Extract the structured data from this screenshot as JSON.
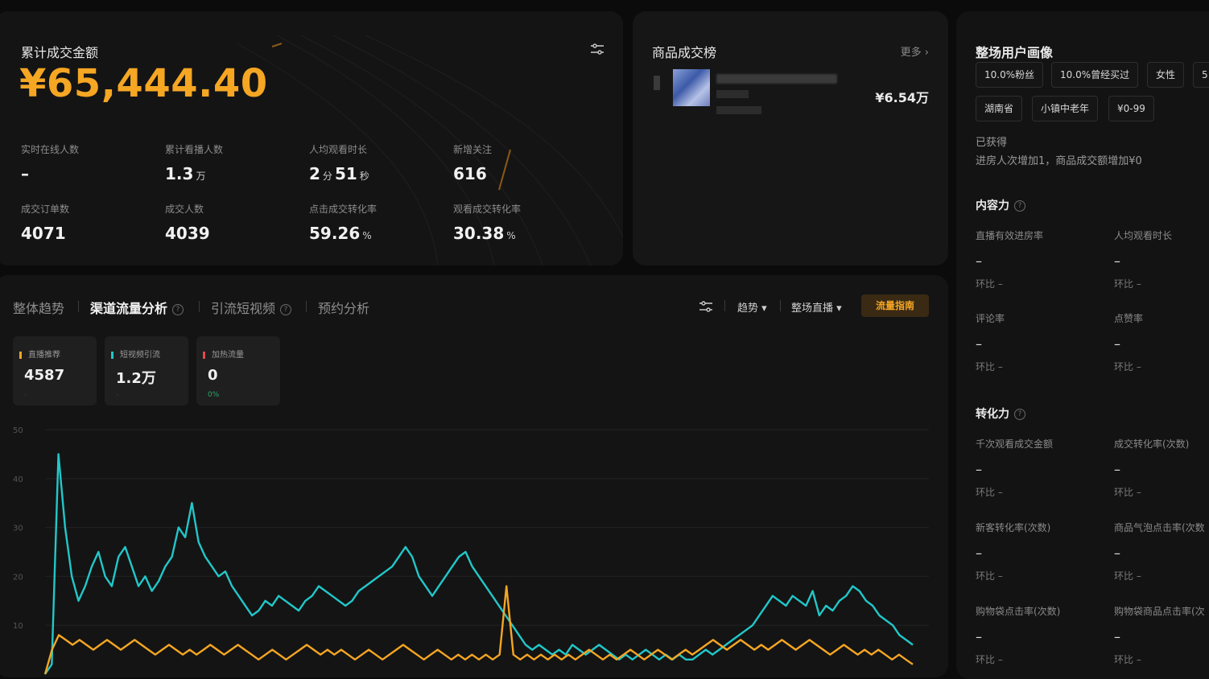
{
  "stats": {
    "title": "累计成交金额",
    "amount": "¥65,444.40",
    "filter_icon": "sliders-icon",
    "metrics": [
      {
        "label": "实时在线人数",
        "value": "–",
        "unit": ""
      },
      {
        "label": "累计看播人数",
        "value": "1.3",
        "unit": "万"
      },
      {
        "label": "人均观看时长",
        "value": "2",
        "unit": "分",
        "value2": "51",
        "unit2": "秒"
      },
      {
        "label": "新增关注",
        "value": "616",
        "unit": ""
      },
      {
        "label": "成交订单数",
        "value": "4071",
        "unit": ""
      },
      {
        "label": "成交人数",
        "value": "4039",
        "unit": ""
      },
      {
        "label": "点击成交转化率",
        "value": "59.26",
        "unit": "%"
      },
      {
        "label": "观看成交转化率",
        "value": "30.38",
        "unit": "%"
      }
    ]
  },
  "product": {
    "title": "商品成交榜",
    "more": "更多 ›",
    "price": "¥6.54万"
  },
  "profile": {
    "title": "整场用户画像",
    "tags": [
      "10.0%粉丝",
      "10.0%曾经买过",
      "女性",
      "5",
      "湖南省",
      "小镇中老年",
      "¥0-99"
    ],
    "obtained_label": "已获得",
    "obtained_text": "进房人次增加1，商品成交额增加¥0",
    "content_section": "内容力",
    "content_metrics": [
      {
        "label": "直播有效进房率",
        "value": "–",
        "compare": "环比 –"
      },
      {
        "label": "人均观看时长",
        "value": "–",
        "compare": "环比 –"
      },
      {
        "label": "评论率",
        "value": "–",
        "compare": "环比 –"
      },
      {
        "label": "点赞率",
        "value": "–",
        "compare": "环比 –"
      }
    ],
    "conversion_section": "转化力",
    "conversion_metrics": [
      {
        "label": "千次观看成交金额",
        "value": "–",
        "compare": "环比 –"
      },
      {
        "label": "成交转化率(次数)",
        "value": "–",
        "compare": "环比 –"
      },
      {
        "label": "新客转化率(次数)",
        "value": "–",
        "compare": "环比 –"
      },
      {
        "label": "商品气泡点击率(次数",
        "value": "–",
        "compare": "环比 –"
      },
      {
        "label": "购物袋点击率(次数)",
        "value": "–",
        "compare": "环比 –"
      },
      {
        "label": "购物袋商品点击率(次",
        "value": "–",
        "compare": "环比 –"
      }
    ]
  },
  "trend": {
    "tabs": [
      "整体趋势",
      "渠道流量分析",
      "引流短视频",
      "预约分析"
    ],
    "active_tab": 1,
    "controls": {
      "trend": "趋势 ▾",
      "scope": "整场直播 ▾",
      "guide": "流量指南"
    },
    "channels": [
      {
        "name": "直播推荐",
        "value": "4587",
        "sub": "-",
        "color": "#f5a623"
      },
      {
        "name": "短视频引流",
        "value": "1.2万",
        "sub": "-",
        "color": "#22c7c9"
      },
      {
        "name": "加热流量",
        "value": "0",
        "sub": "0%",
        "color": "#e5484d"
      }
    ]
  },
  "chart_data": {
    "type": "line",
    "ylim": [
      0,
      50
    ],
    "yticks": [
      10,
      20,
      30,
      40,
      50
    ],
    "series": [
      {
        "color": "#22c7c9",
        "values": [
          0,
          2,
          45,
          30,
          20,
          15,
          18,
          22,
          25,
          20,
          18,
          24,
          26,
          22,
          18,
          20,
          17,
          19,
          22,
          24,
          30,
          28,
          35,
          27,
          24,
          22,
          20,
          21,
          18,
          16,
          14,
          12,
          13,
          15,
          14,
          16,
          15,
          14,
          13,
          15,
          16,
          18,
          17,
          16,
          15,
          14,
          15,
          17,
          18,
          19,
          20,
          21,
          22,
          24,
          26,
          24,
          20,
          18,
          16,
          18,
          20,
          22,
          24,
          25,
          22,
          20,
          18,
          16,
          14,
          12,
          10,
          8,
          6,
          5,
          6,
          5,
          4,
          5,
          4,
          6,
          5,
          4,
          5,
          6,
          5,
          4,
          3,
          4,
          3,
          4,
          5,
          4,
          3,
          4,
          3,
          4,
          3,
          3,
          4,
          5,
          4,
          5,
          6,
          7,
          8,
          9,
          10,
          12,
          14,
          16,
          15,
          14,
          16,
          15,
          14,
          17,
          12,
          14,
          13,
          15,
          16,
          18,
          17,
          15,
          14,
          12,
          11,
          10,
          8,
          7,
          6
        ]
      },
      {
        "color": "#f5a623",
        "values": [
          0,
          5,
          8,
          7,
          6,
          7,
          6,
          5,
          6,
          7,
          6,
          5,
          6,
          7,
          6,
          5,
          4,
          5,
          6,
          5,
          4,
          5,
          4,
          5,
          6,
          5,
          4,
          5,
          6,
          5,
          4,
          3,
          4,
          5,
          4,
          3,
          4,
          5,
          6,
          5,
          4,
          5,
          4,
          5,
          4,
          3,
          4,
          5,
          4,
          3,
          4,
          5,
          6,
          5,
          4,
          3,
          4,
          5,
          4,
          3,
          4,
          3,
          4,
          3,
          4,
          3,
          4,
          18,
          4,
          3,
          4,
          3,
          4,
          3,
          4,
          3,
          4,
          3,
          4,
          5,
          4,
          3,
          4,
          3,
          4,
          5,
          4,
          3,
          4,
          5,
          4,
          3,
          4,
          5,
          4,
          5,
          6,
          7,
          6,
          5,
          6,
          7,
          6,
          5,
          6,
          5,
          6,
          7,
          6,
          5,
          6,
          7,
          6,
          5,
          4,
          5,
          6,
          5,
          4,
          5,
          4,
          5,
          4,
          3,
          4,
          3,
          2
        ]
      }
    ]
  }
}
